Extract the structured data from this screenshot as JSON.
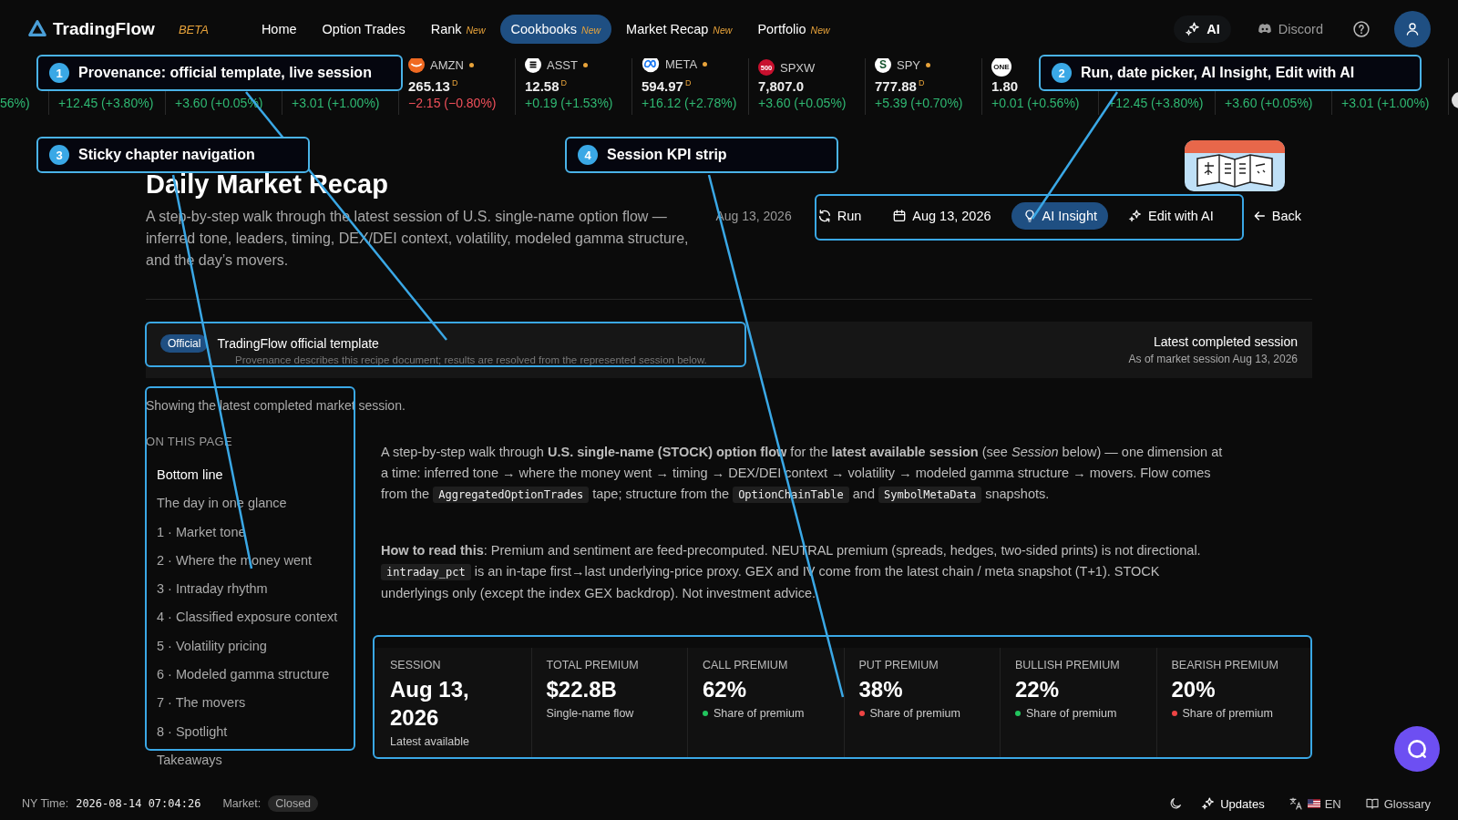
{
  "nav": {
    "logo": "TradingFlow",
    "beta": "BETA",
    "items": [
      {
        "label": "Home",
        "selected": false
      },
      {
        "label": "Option Trades",
        "selected": false
      },
      {
        "label": "Rank",
        "badge": "New",
        "selected": false
      },
      {
        "label": "Cookbooks",
        "badge": "New",
        "selected": true
      },
      {
        "label": "Market Recap",
        "badge": "New",
        "selected": false
      },
      {
        "label": "Portfolio",
        "badge": "New",
        "selected": false
      }
    ],
    "ai_button": "AI",
    "discord": "Discord"
  },
  "ticker": [
    {
      "change": "56%)",
      "color": "#2fb872"
    },
    {
      "change": "+12.45 (+3.80%)",
      "color": "#2fb872"
    },
    {
      "change": "+3.60 (+0.05%)",
      "color": "#2fb872"
    },
    {
      "change": "+3.01 (+1.00%)",
      "color": "#2fb872"
    },
    {
      "kind": "amzn",
      "label": "AMZN",
      "live": true,
      "price": "265.13",
      "flag": "D",
      "change": "−2.15 (−0.80%)",
      "color": "#f0505a"
    },
    {
      "kind": "asst",
      "label": "ASST",
      "live": true,
      "price": "12.58",
      "flag": "D",
      "change": "+0.19 (+1.53%)",
      "color": "#2fb872"
    },
    {
      "kind": "meta",
      "label": "META",
      "live": true,
      "price": "594.97",
      "flag": "D",
      "change": "+16.12 (+2.78%)",
      "color": "#2fb872"
    },
    {
      "kind": "badge",
      "icon_text": "500",
      "label": "SPXW",
      "live": false,
      "price": "7,807.0",
      "change": "+3.60 (+0.05%)",
      "color": "#2fb872"
    },
    {
      "kind": "letter",
      "icon_text": "S",
      "label": "SPY",
      "live": true,
      "price": "777.88",
      "flag": "D",
      "change": "+5.39 (+0.70%)",
      "color": "#2fb872"
    },
    {
      "kind": "small",
      "icon_text": "ONE",
      "price": "1.80",
      "change": "+0.01 (+0.56%)",
      "color": "#2fb872"
    },
    {
      "change": "+12.45 (+3.80%)",
      "color": "#2fb872"
    },
    {
      "change": "+3.60 (+0.05%)",
      "color": "#2fb872"
    },
    {
      "change": "+3.01 (+1.00%)",
      "color": "#2fb872"
    },
    {
      "kind": "plain"
    }
  ],
  "header": {
    "title": "Daily Market Recap",
    "description": "A step-by-step walk through the latest session of U.S. single-name option flow — inferred tone, leaders, timing, DEX/DEI context, volatility, modeled gamma structure, and the day’s movers.",
    "date_text": "Aug 13, 2026",
    "actions": [
      {
        "label": "Run",
        "selected": false
      },
      {
        "label": "Aug 13, 2026",
        "selected": false
      },
      {
        "label": "AI Insight",
        "selected": true
      },
      {
        "label": "Edit with AI",
        "selected": false
      }
    ],
    "back": "Back"
  },
  "provenance": {
    "badge": "Official",
    "title": "TradingFlow official template",
    "note": "Provenance describes this recipe document; results are resolved from the represented session below.",
    "session_label": "Latest completed session",
    "session_note": "As of market session Aug 13, 2026"
  },
  "notice": "Showing the latest completed market session.",
  "toc": {
    "heading": "ON THIS PAGE",
    "items": [
      {
        "label": "Bottom line",
        "selected": true
      },
      {
        "label": "The day in one glance",
        "selected": false
      },
      {
        "label": "1 · Market tone",
        "selected": false
      },
      {
        "label": "2 · Where the money went",
        "selected": false
      },
      {
        "label": "3 · Intraday rhythm",
        "selected": false
      },
      {
        "label": "4 · Classified exposure context",
        "selected": false
      },
      {
        "label": "5 · Volatility pricing",
        "selected": false
      },
      {
        "label": "6 · Modeled gamma structure",
        "selected": false
      },
      {
        "label": "7 · The movers",
        "selected": false
      },
      {
        "label": "8 · Spotlight",
        "selected": false
      },
      {
        "label": "Takeaways",
        "selected": false
      }
    ]
  },
  "paragraphs": [
    [
      {
        "kind": "text",
        "text": "A step-by-step walk through **U.S. single-name (STOCK) option flow** for the **latest available session** (see *Session* below) — one dimension at a time: inferred tone → where the money went → timing → DEX/DEI context → volatility → modeled gamma structure → movers. Flow comes from the "
      },
      {
        "kind": "code",
        "text": "AggregatedOptionTrades"
      },
      {
        "kind": "text",
        "text": " tape; structure from the "
      },
      {
        "kind": "code",
        "text": "OptionChainTable"
      },
      {
        "kind": "text",
        "text": " and "
      },
      {
        "kind": "code",
        "text": "SymbolMetaData"
      },
      {
        "kind": "text",
        "text": " snapshots."
      }
    ],
    [
      {
        "kind": "text",
        "text": "**How to read this**: Premium and sentiment are feed-precomputed. NEUTRAL premium (spreads, hedges, two-sided prints) is not directional. "
      },
      {
        "kind": "code",
        "text": "intraday_pct"
      },
      {
        "kind": "text",
        "text": " is an in-tape first→last underlying-price proxy. GEX and IV come from the latest chain / meta snapshot (T+1). STOCK underlyings only (except the index GEX backdrop). Not investment advice."
      }
    ]
  ],
  "kpis": [
    {
      "label": "SESSION",
      "value": "Aug 13, 2026",
      "sub": "Latest available"
    },
    {
      "label": "TOTAL PREMIUM",
      "value": "$22.8B",
      "sub": "Single-name flow"
    },
    {
      "label": "CALL PREMIUM",
      "value": "62%",
      "sub": "Share of premium",
      "color": "#22c55e"
    },
    {
      "label": "PUT PREMIUM",
      "value": "38%",
      "sub": "Share of premium",
      "color": "#ef4444"
    },
    {
      "label": "BULLISH PREMIUM",
      "value": "22%",
      "sub": "Share of premium",
      "color": "#22c55e"
    },
    {
      "label": "BEARISH PREMIUM",
      "value": "20%",
      "sub": "Share of premium",
      "color": "#ef4444"
    }
  ],
  "footer": {
    "time_label": "NY Time:",
    "time": "2026-08-14 07:04:26",
    "market_label": "Market:",
    "market_status": "Closed",
    "updates": "Updates",
    "language": "EN",
    "glossary": "Glossary"
  },
  "annotations": [
    {
      "number": "1",
      "label": "Provenance: official template, live session"
    },
    {
      "number": "2",
      "label": "Run, date picker, AI Insight, Edit with AI"
    },
    {
      "number": "3",
      "label": "Sticky chapter navigation"
    },
    {
      "number": "4",
      "label": "Session KPI strip"
    }
  ]
}
